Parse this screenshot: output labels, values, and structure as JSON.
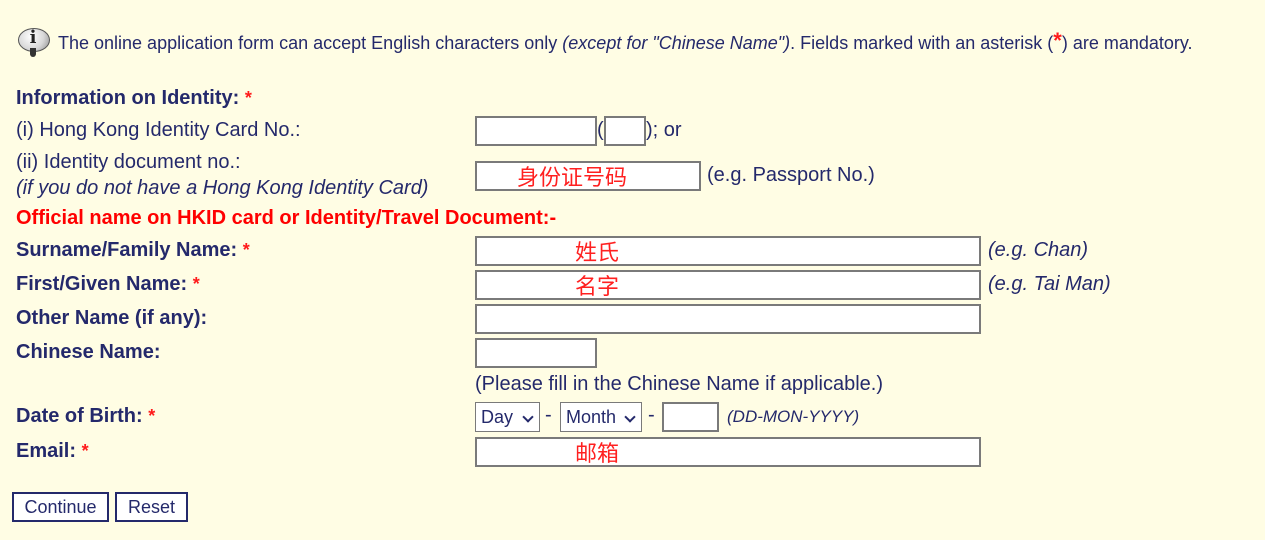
{
  "notice": {
    "text_before": "The online application form can accept English characters only",
    "text_italic": "(except for \"Chinese Name\")",
    "text_after_1": ". Fields marked with an asterisk (",
    "asterisk": "*",
    "text_after_2": ") are mandatory."
  },
  "identity": {
    "heading": "Information on Identity:",
    "hkid_label": "(i)  Hong Kong Identity Card No.:",
    "hkid_paren_open": "(",
    "hkid_paren_close": "); or",
    "doc_label_line1": "(ii) Identity document no.:",
    "doc_label_line2": "(if you do not have a Hong Kong Identity Card)",
    "doc_overlay": "身份证号码",
    "doc_hint": "(e.g. Passport No.)"
  },
  "official_heading": "Official name on HKID card or Identity/Travel Document:-",
  "surname": {
    "label": "Surname/Family Name:",
    "overlay": "姓氏",
    "hint": "(e.g. Chan)"
  },
  "given": {
    "label": "First/Given Name:",
    "overlay": "名字",
    "hint": "(e.g. Tai Man)"
  },
  "other": {
    "label": "Other Name (if any):"
  },
  "chinese": {
    "label": "Chinese Name:",
    "note": "(Please fill in the Chinese Name if applicable.)"
  },
  "dob": {
    "label": "Date of Birth:",
    "day": "Day",
    "month": "Month",
    "sep": "-",
    "format": "(DD-MON-YYYY)"
  },
  "email": {
    "label": "Email:",
    "overlay": "邮箱"
  },
  "asterisk": "*",
  "buttons": {
    "continue": "Continue",
    "reset": "Reset"
  },
  "colors": {
    "background": "#fffde4",
    "text": "#24296b",
    "required": "#ff0000"
  },
  "icons": {
    "notice": "info-icon"
  }
}
